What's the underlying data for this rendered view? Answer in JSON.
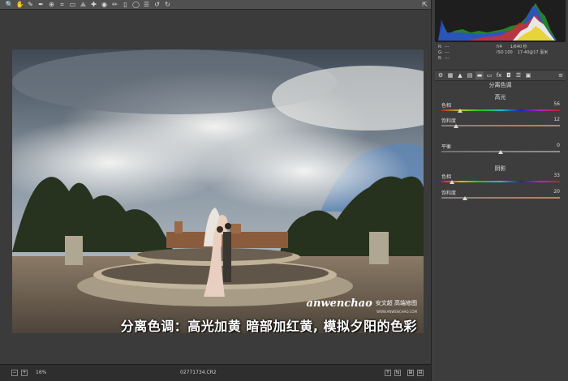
{
  "toolbar": {
    "tools": [
      {
        "icon": "zoom-icon",
        "glyph": "🔍"
      },
      {
        "icon": "hand-icon",
        "glyph": "✋"
      },
      {
        "icon": "white-balance-icon",
        "glyph": "✎"
      },
      {
        "icon": "color-sampler-icon",
        "glyph": "✒"
      },
      {
        "icon": "target-adjust-icon",
        "glyph": "⊕"
      },
      {
        "icon": "crop-icon",
        "glyph": "⌗"
      },
      {
        "icon": "straighten-icon",
        "glyph": "▭"
      },
      {
        "icon": "transform-icon",
        "glyph": "⟁"
      },
      {
        "icon": "spot-removal-icon",
        "glyph": "✚"
      },
      {
        "icon": "red-eye-icon",
        "glyph": "◉"
      },
      {
        "icon": "brush-icon",
        "glyph": "✏"
      },
      {
        "icon": "graduated-filter-icon",
        "glyph": "▯"
      },
      {
        "icon": "radial-filter-icon",
        "glyph": "◯"
      },
      {
        "icon": "preferences-icon",
        "glyph": "☰"
      },
      {
        "icon": "rotate-left-icon",
        "glyph": "↺"
      },
      {
        "icon": "rotate-right-icon",
        "glyph": "↻"
      }
    ],
    "right_icon": "fullscreen-icon",
    "right_glyph": "⇱"
  },
  "photo": {
    "watermark_script": "anwenchao",
    "watermark_cn": "安文超 高端修图",
    "watermark_url": "WWW.ANWENCHAO.COM",
    "caption": "分离色调：高光加黄 暗部加红黄, 模拟夕阳的色彩"
  },
  "statusbar": {
    "zoom": "16%",
    "filename": "02771734.CR2",
    "btn_left1": "−",
    "btn_left2": "+",
    "btn_right1": "Y",
    "btn_right2": "⇆",
    "btn_right3": "⊞",
    "btn_right4": "⊟"
  },
  "info": {
    "r_label": "R:",
    "r_val": "---",
    "g_label": "G:",
    "g_val": "---",
    "b_label": "B:",
    "b_val": "---",
    "aperture": "f/4",
    "shutter": "1/640 秒",
    "iso": "ISO 100",
    "lens": "17-40@17 毫米"
  },
  "tabs": {
    "icons": [
      "basic-icon",
      "tone-curve-icon",
      "detail-icon",
      "hsl-icon",
      "split-toning-icon",
      "lens-icon",
      "fx-icon",
      "camera-calibration-icon",
      "presets-icon",
      "snapshots-icon"
    ],
    "glyphs": [
      "⚙",
      "▦",
      "▲",
      "▤",
      "▬",
      "▭",
      "fx",
      "◘",
      "☰",
      "▣"
    ],
    "menu_glyph": "≡"
  },
  "panel": {
    "title": "分离色调",
    "highlights_title": "高光",
    "highlights": [
      {
        "label": "色相",
        "value": "56",
        "fraction": 0.16,
        "track": "hue"
      },
      {
        "label": "饱和度",
        "value": "12",
        "fraction": 0.12,
        "track": "sat"
      }
    ],
    "balance": {
      "label": "平衡",
      "value": "0",
      "fraction": 0.5,
      "track": "gray"
    },
    "shadows_title": "阴影",
    "shadows": [
      {
        "label": "色相",
        "value": "33",
        "fraction": 0.09,
        "track": "hue"
      },
      {
        "label": "饱和度",
        "value": "20",
        "fraction": 0.2,
        "track": "sat"
      }
    ]
  },
  "colors": {
    "panel_bg": "#3d3d3d",
    "toolbar_bg": "#505050",
    "canvas_bg": "#3b3b3b"
  }
}
